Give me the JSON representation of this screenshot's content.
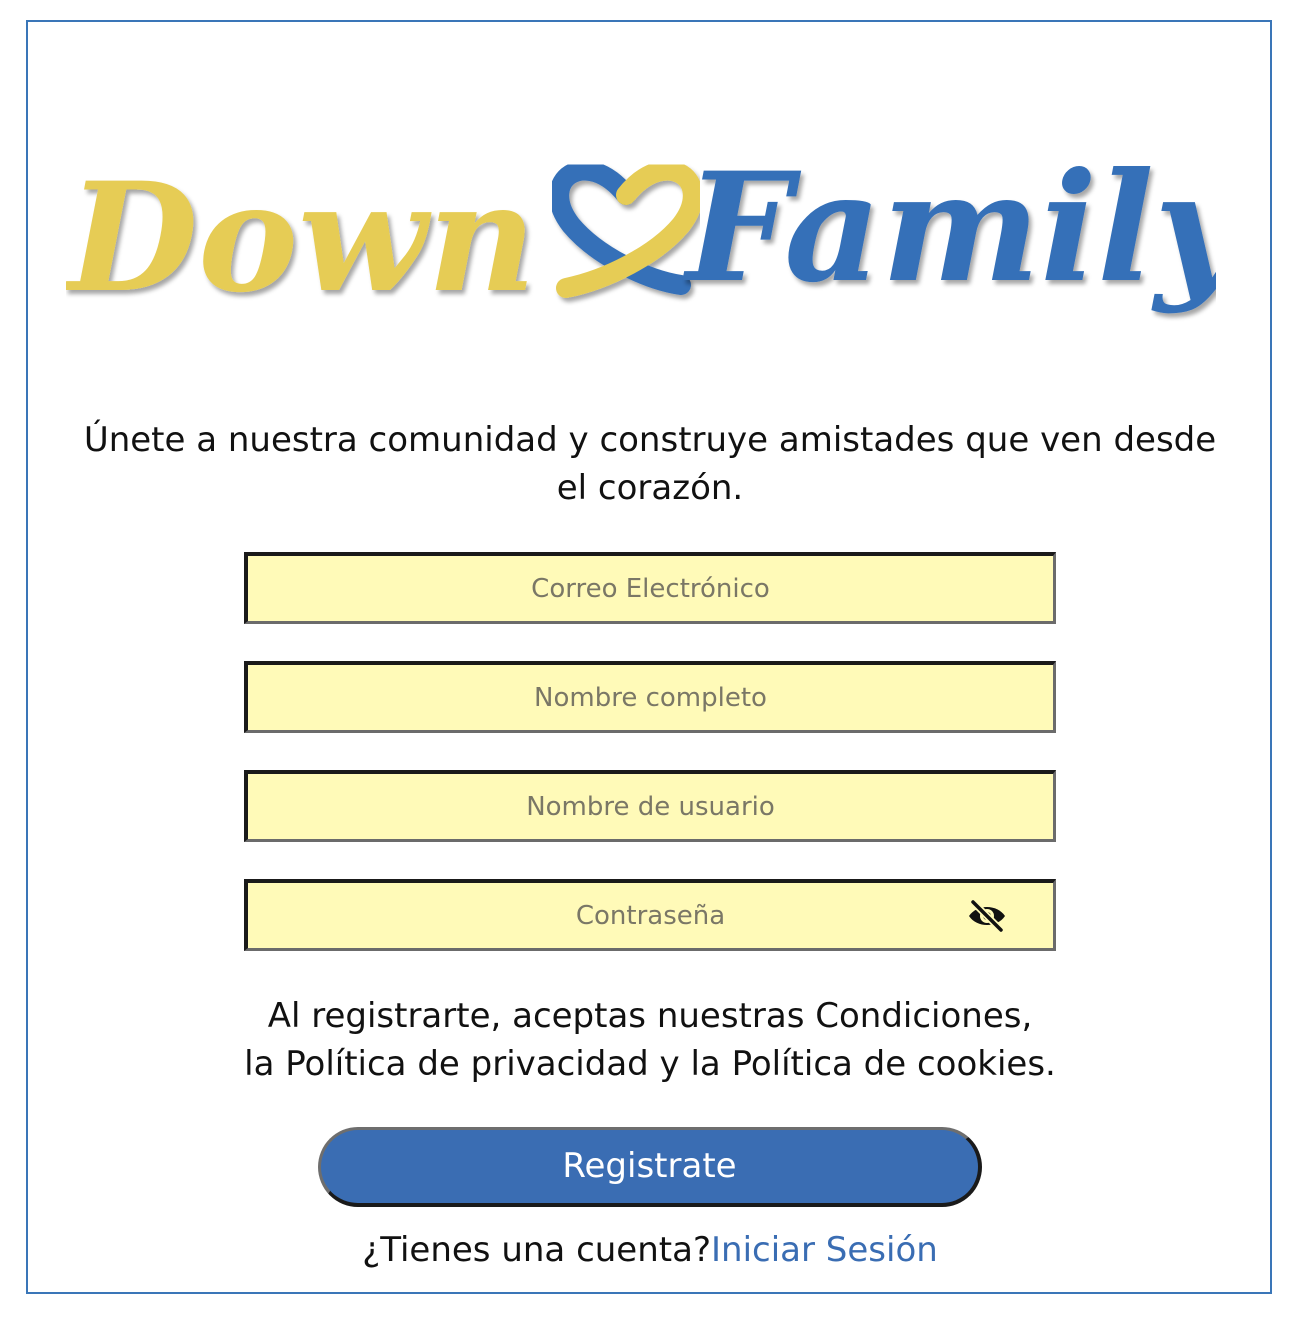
{
  "logo": {
    "text_left": "Down",
    "text_right": "Family",
    "colors": {
      "yellow": "#e6cc55",
      "blue": "#3570b8"
    },
    "icon": "heart-ribbon-icon"
  },
  "tagline": "Únete a nuestra comunidad y construye amistades que ven desde el corazón.",
  "form": {
    "email_placeholder": "Correo Electrónico",
    "fullname_placeholder": "Nombre completo",
    "username_placeholder": "Nombre de usuario",
    "password_placeholder": "Contraseña",
    "password_toggle_icon": "eye-slash-icon"
  },
  "terms": {
    "line1": "Al registrarte, aceptas nuestras Condiciones,",
    "line2": "la Política de privacidad y la Política de cookies."
  },
  "register_label": "Registrate",
  "login": {
    "prompt": "¿Tienes una cuenta?",
    "link": "Iniciar Sesión"
  },
  "colors": {
    "field_bg": "#fffab8",
    "button_bg": "#3a6db3",
    "border_blue": "#3a76b8"
  }
}
